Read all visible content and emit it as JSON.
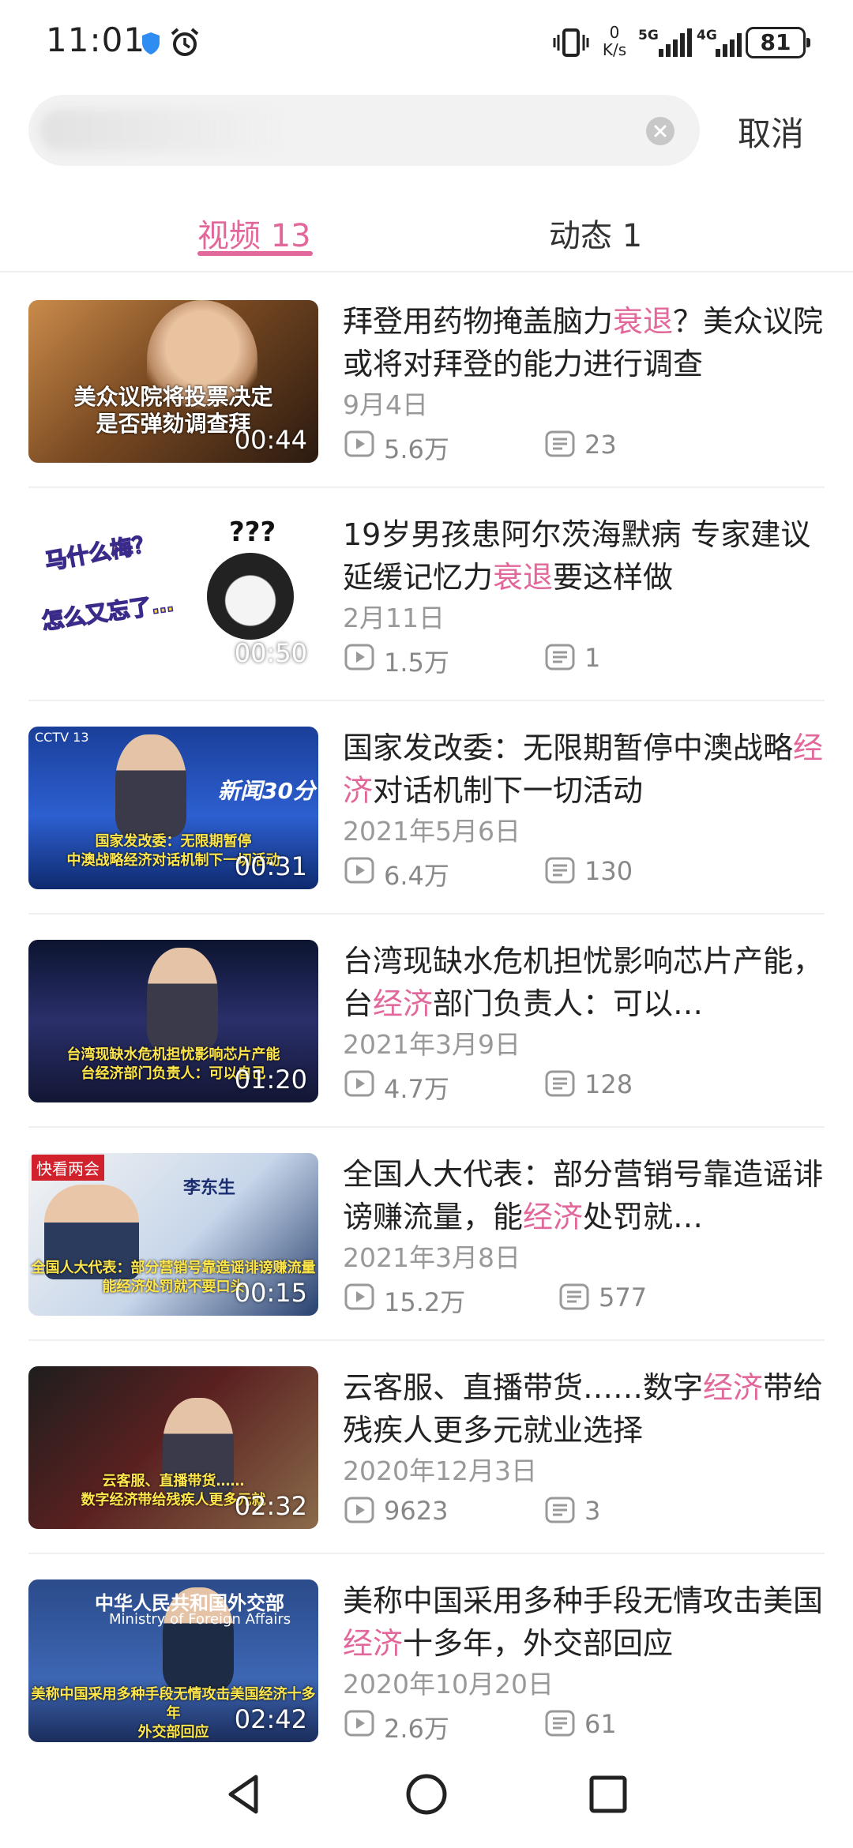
{
  "status_bar": {
    "time": "11:01",
    "net_speed_value": "0",
    "net_speed_unit": "K/s",
    "net1": "5G",
    "net2": "4G",
    "battery": "81"
  },
  "search": {
    "placeholder": "",
    "cancel_label": "取消"
  },
  "tabs": [
    {
      "label": "视频 13",
      "active": true
    },
    {
      "label": "动态 1",
      "active": false
    }
  ],
  "results": [
    {
      "title": "拜登用药物掩盖脑力衰退？美众议院或将对拜登的能力进行调查",
      "highlight": "衰退",
      "date": "9月4日",
      "views": "5.6万",
      "comments": "23",
      "duration": "00:44",
      "caption": [
        "美众议院将投票决定",
        "是否弹劾调查拜"
      ]
    },
    {
      "title": "19岁男孩患阿尔茨海默病 专家建议延缓记忆力衰退要这样做",
      "highlight": "衰退",
      "date": "2月11日",
      "views": "1.5万",
      "comments": "1",
      "duration": "00:50",
      "caption": [
        "马什么梅？",
        "怎么又忘了…",
        "???"
      ]
    },
    {
      "title": "国家发改委：无限期暂停中澳战略经济对话机制下一切活动",
      "highlight": "经济",
      "date": "2021年5月6日",
      "views": "6.4万",
      "comments": "130",
      "duration": "00:31",
      "caption": [
        "国家发改委：无限期暂停",
        "中澳战略经济对话机制下一切活动",
        "新闻30分",
        "CCTV 13"
      ]
    },
    {
      "title": "台湾现缺水危机担忧影响芯片产能，台经济部门负责人：可以…",
      "highlight": "经济",
      "date": "2021年3月9日",
      "views": "4.7万",
      "comments": "128",
      "duration": "01:20",
      "caption": [
        "台湾现缺水危机担忧影响芯片产能",
        "台经济部门负责人：可以自己"
      ]
    },
    {
      "title": "全国人大代表：部分营销号靠造谣诽谤赚流量，能经济处罚就…",
      "highlight": "经济",
      "date": "2021年3月8日",
      "views": "15.2万",
      "comments": "577",
      "duration": "00:15",
      "caption": [
        "全国人大代表：部分营销号靠造谣诽谤赚流量",
        "能经济处罚就不要口头",
        "快看两会",
        "李东生"
      ]
    },
    {
      "title": "云客服、直播带货……数字经济带给残疾人更多元就业选择",
      "highlight": "经济",
      "date": "2020年12月3日",
      "views": "9623",
      "comments": "3",
      "duration": "02:32",
      "caption": [
        "云客服、直播带货……",
        "数字经济带给残疾人更多元就"
      ]
    },
    {
      "title": "美称中国采用多种手段无情攻击美国经济十多年，外交部回应",
      "highlight": "经济",
      "date": "2020年10月20日",
      "views": "2.6万",
      "comments": "61",
      "duration": "02:42",
      "caption": [
        "中华人民共和国外交部",
        "Ministry of Foreign Affairs",
        "美称中国采用多种手段无情攻击美国经济十多年",
        "外交部回应"
      ]
    }
  ],
  "colors": {
    "accent": "#e2679a",
    "text": "#222222",
    "meta": "#999999"
  },
  "nav": [
    "back-icon",
    "home-icon",
    "recents-icon"
  ]
}
